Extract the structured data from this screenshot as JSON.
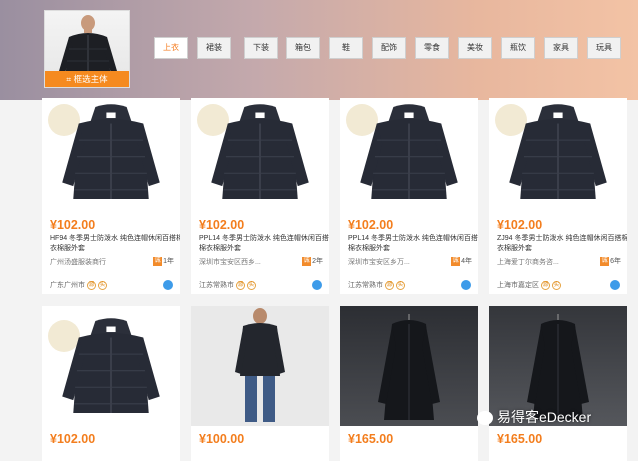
{
  "main_image": {
    "crop_label": "框选主体"
  },
  "tabs": [
    {
      "label": "上衣",
      "active": true
    },
    {
      "label": "裙装"
    },
    {
      "label": "下装"
    },
    {
      "label": "箱包"
    },
    {
      "label": "鞋"
    },
    {
      "label": "配饰"
    },
    {
      "label": "零食"
    },
    {
      "label": "美妆"
    },
    {
      "label": "瓶饮"
    },
    {
      "label": "家具"
    },
    {
      "label": "玩具"
    }
  ],
  "products": [
    {
      "price": "¥102.00",
      "title": "HF94 冬季男士防泼水 纯色连帽休闲百搭棉衣棉服外套",
      "shop": "广州汤盛服装商行",
      "years": "1年",
      "location": "广东广州市"
    },
    {
      "price": "¥102.00",
      "title": "PPL14 冬季男士防泼水 纯色连帽休闲百搭棉衣棉服外套",
      "shop": "深圳市宝安区西乡...",
      "years": "2年",
      "location": "江苏常熟市"
    },
    {
      "price": "¥102.00",
      "title": "PPL14 冬季男士防泼水 纯色连帽休闲百搭棉衣棉服外套",
      "shop": "深圳市宝安区乡万...",
      "years": "4年",
      "location": "江苏常熟市"
    },
    {
      "price": "¥102.00",
      "title": "ZJ94 冬季男士防泼水 纯色连帽休闲百搭棉衣棉服外套",
      "shop": "上海爱丁尔商务咨...",
      "years": "6年",
      "location": "上海市嘉定区"
    },
    {
      "price": "¥102.00"
    },
    {
      "price": "¥100.00"
    },
    {
      "price": "¥165.00"
    },
    {
      "price": "¥165.00"
    }
  ],
  "badges": {
    "a": "源",
    "b": "实"
  },
  "watermark": "易得客eDecker",
  "colors": {
    "accent": "#f37e1e",
    "chat": "#3d9be9"
  }
}
